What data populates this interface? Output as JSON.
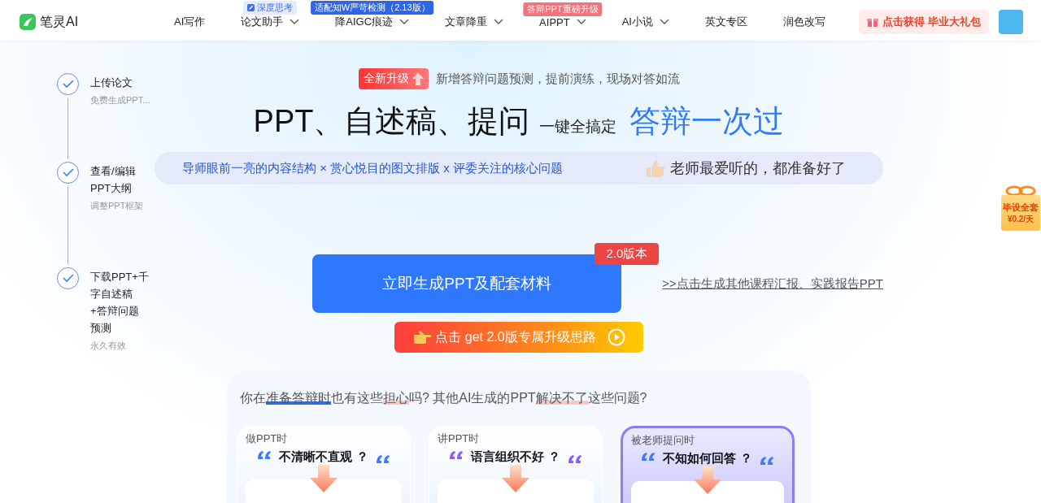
{
  "header": {
    "logo": "笔灵AI",
    "nav": [
      {
        "label": "AI写作",
        "dropdown": false
      },
      {
        "label": "论文助手",
        "dropdown": true,
        "badge": {
          "text": "深度思考",
          "kind": "soft"
        }
      },
      {
        "label": "降AIGC痕迹",
        "dropdown": true,
        "badge": {
          "text": "适配知W严苛检测（2.13版）",
          "kind": "blue"
        }
      },
      {
        "label": "文章降重",
        "dropdown": true
      },
      {
        "label": "AIPPT",
        "dropdown": true,
        "badge": {
          "text": "答辩PPT重磅升级",
          "kind": "red"
        }
      },
      {
        "label": "AI小说",
        "dropdown": true
      },
      {
        "label": "英文专区",
        "dropdown": false
      },
      {
        "label": "润色改写",
        "dropdown": false
      }
    ],
    "promo": "点击获得 毕业大礼包"
  },
  "steps": [
    {
      "title_lines": [
        "上传论文"
      ],
      "sub": "免费生成PPT...",
      "checked": true
    },
    {
      "title_lines": [
        "查看/编辑",
        "PPT大纲"
      ],
      "sub": "调整PPT框架",
      "checked": true
    },
    {
      "title_lines": [
        "下载PPT+千",
        "字自述稿",
        "+答辩问题",
        "预测"
      ],
      "sub": "永久有效",
      "checked": true
    }
  ],
  "banner": {
    "tag": "全新升级",
    "text": "新增答辩问题预测，提前演练，现场对答如流"
  },
  "headline": {
    "main": "PPT、自述稿、提问",
    "small": "一键全搞定",
    "accent": "答辩一次过"
  },
  "pill": {
    "features": "导师眼前一亮的内容结构 × 赏心悦目的图文排版 x 评委关注的核心问题",
    "praise": "老师最爱听的，都准备好了"
  },
  "cta": {
    "label": "立即生成PPT及配套材料",
    "badge": "2.0版本",
    "link": ">>点击生成其他课程汇报、实践报告PPT",
    "upgrade": "点击 get 2.0版专属升级思路"
  },
  "problems": {
    "question": [
      {
        "text": "你在",
        "kind": "plain"
      },
      {
        "text": "准备答辩时",
        "kind": "strong"
      },
      {
        "text": "也有这些",
        "kind": "plain"
      },
      {
        "text": "担心",
        "kind": "soft"
      },
      {
        "text": "吗?  其他AI生成的PPT",
        "kind": "plain"
      },
      {
        "text": "解决不了",
        "kind": "soft"
      },
      {
        "text": "这些问题?",
        "kind": "plain"
      }
    ],
    "cards": [
      {
        "label": "做PPT时",
        "complaint": "不清晰不直观 ？",
        "color": "#3b7cff",
        "selected": false
      },
      {
        "label": "讲PPT时",
        "complaint": "语言组织不好 ？",
        "color": "#8b5cf6",
        "selected": false
      },
      {
        "label": "被老师提问时",
        "complaint": "不知如何回答 ？",
        "color": "#3b7cff",
        "selected": true
      }
    ]
  },
  "gift": {
    "line1": "毕设全套",
    "line2": "¥0.2/天"
  }
}
